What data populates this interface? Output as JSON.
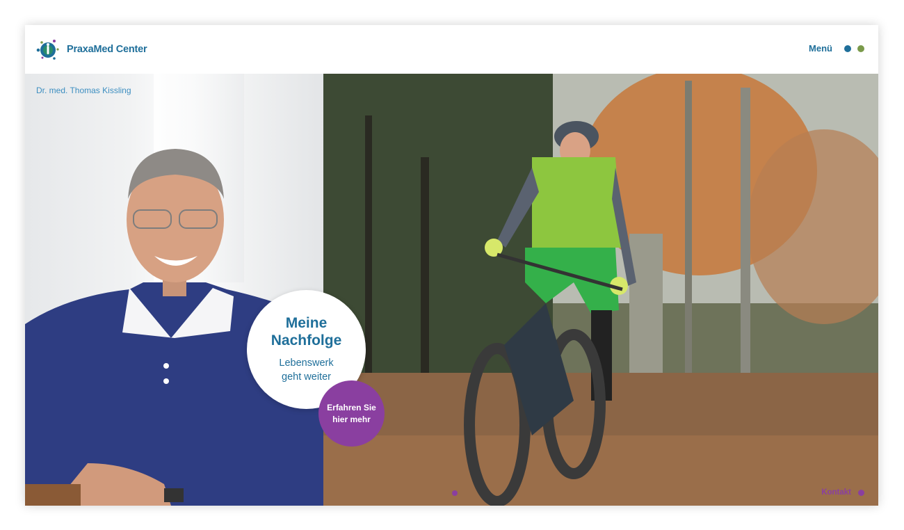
{
  "header": {
    "logo_text": "PraxaMed Center",
    "menu_label": "Menü",
    "dot_colors": [
      "#1f6f9a",
      "#7a9a4a"
    ]
  },
  "left": {
    "doctor_name": "Dr. med. Thomas Kissling"
  },
  "badge": {
    "title_line1": "Meine",
    "title_line2": "Nachfolge",
    "sub_line1": "Lebenswerk",
    "sub_line2": "geht weiter"
  },
  "cta": {
    "line1": "Erfahren Sie",
    "line2": "hier mehr"
  },
  "footer": {
    "kontakt_label": "Kontakt"
  },
  "colors": {
    "brand_blue": "#1f6f9a",
    "accent_purple": "#8a3fa0",
    "accent_green": "#7a9a4a"
  }
}
